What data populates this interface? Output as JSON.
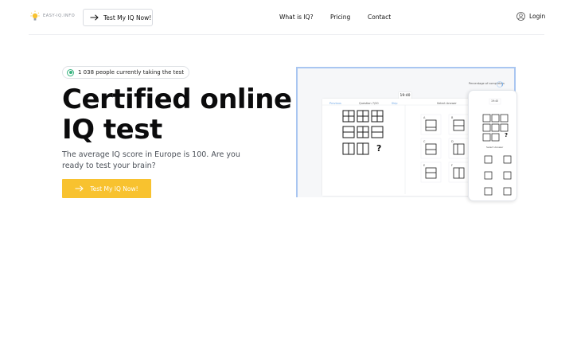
{
  "header": {
    "logo_text": "EASY-IQ.INFO",
    "cta_label": "Test My IQ Now!",
    "nav": [
      {
        "label": "What is IQ?"
      },
      {
        "label": "Pricing"
      },
      {
        "label": "Contact"
      }
    ],
    "login_label": "Login"
  },
  "hero": {
    "badge_text": "1 038 people currently taking the test",
    "title_line1": "Certified online",
    "title_line2": "IQ test",
    "subtitle": "The average IQ score in Europe is 100. Are you ready to test your brain?",
    "cta_label": "Test My IQ Now!"
  },
  "mockup": {
    "timer": "19:40",
    "question_label": "Question 7/20",
    "previous_label": "Previous",
    "skip_label": "Skip",
    "select_answer_label": "Select Answer",
    "completion_label": "Percentage of completion",
    "question_mark": "?",
    "answer_options": [
      "A",
      "B",
      "C",
      "D",
      "E",
      "F"
    ]
  },
  "colors": {
    "accent": "#f8c22f",
    "badge_green": "#36b37e",
    "mockup_frame": "#a9c6f1"
  }
}
